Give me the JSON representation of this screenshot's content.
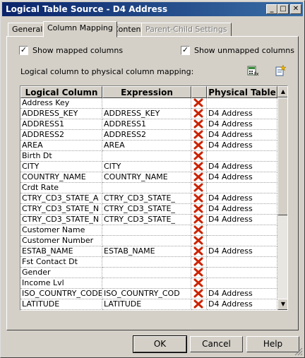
{
  "window": {
    "title": "Logical Table Source - D4 Address"
  },
  "titlebar_buttons": {
    "minimize": "_",
    "maximize": "□",
    "close": "✕"
  },
  "tabs": [
    {
      "label": "General",
      "state": "normal"
    },
    {
      "label": "Column Mapping",
      "state": "active"
    },
    {
      "label": "Content",
      "state": "normal"
    },
    {
      "label": "Parent-Child Settings",
      "state": "disabled"
    }
  ],
  "options": {
    "show_mapped": {
      "label": "Show mapped columns",
      "checked": true
    },
    "show_unmapped": {
      "label": "Show unmapped columns",
      "checked": true
    }
  },
  "mapping": {
    "caption": "Logical column to physical column mapping:",
    "tool_icons": [
      "expression-builder-icon",
      "add-mapping-icon"
    ],
    "columns": [
      "Logical Column",
      "Expression",
      "",
      "Physical Table"
    ],
    "rows": [
      {
        "logical": "Address Key",
        "expression": "",
        "table": ""
      },
      {
        "logical": "ADDRESS_KEY",
        "expression": "ADDRESS_KEY",
        "table": "D4 Address"
      },
      {
        "logical": "ADDRESS1",
        "expression": "ADDRESS1",
        "table": "D4 Address"
      },
      {
        "logical": "ADDRESS2",
        "expression": "ADDRESS2",
        "table": "D4 Address"
      },
      {
        "logical": "AREA",
        "expression": "AREA",
        "table": "D4 Address"
      },
      {
        "logical": "Birth Dt",
        "expression": "",
        "table": ""
      },
      {
        "logical": "CITY",
        "expression": "CITY",
        "table": "D4 Address"
      },
      {
        "logical": "COUNTRY_NAME",
        "expression": "COUNTRY_NAME",
        "table": "D4 Address"
      },
      {
        "logical": "Crdt Rate",
        "expression": "",
        "table": ""
      },
      {
        "logical": "CTRY_CD3_STATE_A",
        "expression": "CTRY_CD3_STATE_",
        "table": "D4 Address"
      },
      {
        "logical": "CTRY_CD3_STATE_N",
        "expression": "CTRY_CD3_STATE_",
        "table": "D4 Address"
      },
      {
        "logical": "CTRY_CD3_STATE_N",
        "expression": "CTRY_CD3_STATE_",
        "table": "D4 Address"
      },
      {
        "logical": "Customer Name",
        "expression": "",
        "table": ""
      },
      {
        "logical": "Customer Number",
        "expression": "",
        "table": ""
      },
      {
        "logical": "ESTAB_NAME",
        "expression": "ESTAB_NAME",
        "table": "D4 Address"
      },
      {
        "logical": "Fst Contact Dt",
        "expression": "",
        "table": ""
      },
      {
        "logical": "Gender",
        "expression": "",
        "table": ""
      },
      {
        "logical": "Income Lvl",
        "expression": "",
        "table": ""
      },
      {
        "logical": "ISO_COUNTRY_CODE",
        "expression": "ISO_COUNTRY_COD",
        "table": "D4 Address"
      },
      {
        "logical": "LATITUDE",
        "expression": "LATITUDE",
        "table": "D4 Address"
      }
    ]
  },
  "buttons": {
    "ok": "OK",
    "cancel": "Cancel",
    "help": "Help"
  },
  "colors": {
    "delete_icon": "#cc2200",
    "titlebar_start": "#0a246a",
    "titlebar_end": "#3a6ea5"
  }
}
